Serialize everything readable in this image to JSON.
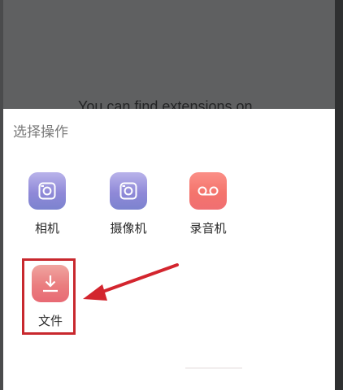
{
  "background_text": "You can find extensions on",
  "sheet": {
    "title": "选择操作"
  },
  "actions": [
    {
      "label": "相机",
      "icon": "camera-icon",
      "color": "#8f89d8"
    },
    {
      "label": "摄像机",
      "icon": "video-camera-icon",
      "color": "#8f89d8"
    },
    {
      "label": "录音机",
      "icon": "voice-recorder-icon",
      "color": "#f4746c"
    },
    {
      "label": "文件",
      "icon": "file-download-icon",
      "color": "#ea7d7f"
    }
  ],
  "annotation": {
    "highlight_color": "#c8282e",
    "arrow_color": "#d3252e"
  }
}
